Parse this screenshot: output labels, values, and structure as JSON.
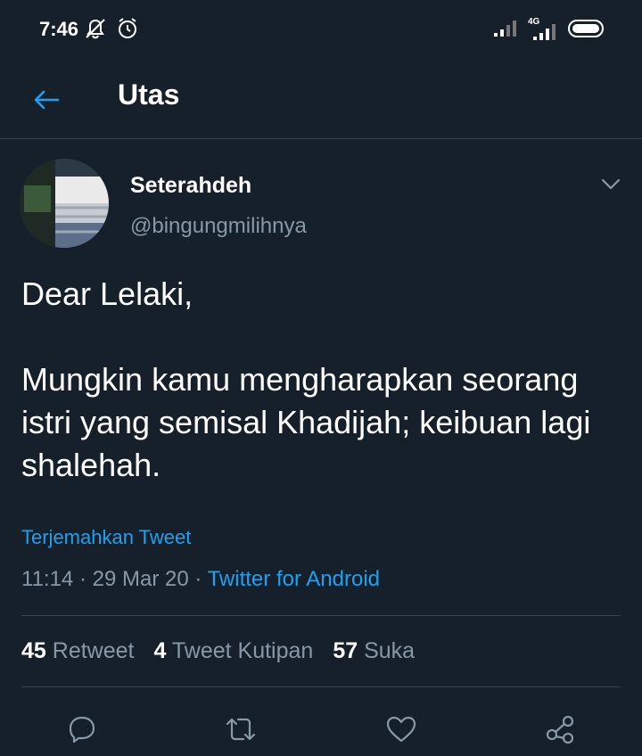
{
  "status_bar": {
    "time": "7:46",
    "network_label": "4G",
    "icons": [
      "notifications-off-icon",
      "alarm-icon",
      "signal-icon",
      "signal-4g-icon",
      "battery-icon"
    ]
  },
  "header": {
    "title": "Utas",
    "back_icon": "back-arrow-icon"
  },
  "tweet": {
    "display_name": "Seterahdeh",
    "handle": "@bingungmilihnya",
    "text": "Dear Lelaki,\n\nMungkin kamu mengharapkan seorang istri yang semisal Khadijah; keibuan lagi shalehah.",
    "translate_label": "Terjemahkan Tweet",
    "time": "11:14",
    "date": "29 Mar 20",
    "source": "Twitter for Android"
  },
  "stats": {
    "retweets_count": "45",
    "retweets_label": "Retweet",
    "quotes_count": "4",
    "quotes_label": "Tweet Kutipan",
    "likes_count": "57",
    "likes_label": "Suka"
  },
  "actions": [
    "reply-icon",
    "retweet-icon",
    "like-icon",
    "share-icon"
  ],
  "colors": {
    "background": "#15202b",
    "accent": "#1da1f2",
    "secondary_text": "#8899a6",
    "divider": "#38444d"
  }
}
